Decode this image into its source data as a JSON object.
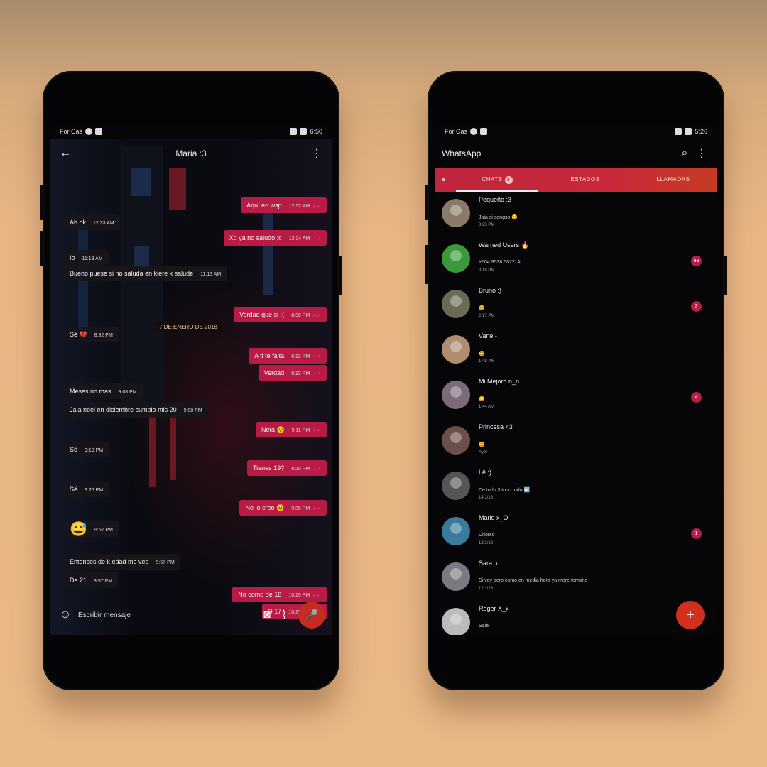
{
  "left_phone": {
    "status": {
      "carrier": "For Cas",
      "time": "6:50"
    },
    "header": {
      "title": "Maria :3",
      "back_icon": "arrow-left-icon",
      "menu_icon": "more-vert-icon"
    },
    "messages": [
      {
        "dir": "out",
        "text": "Aquí en wsp",
        "time": "12:32 AM"
      },
      {
        "dir": "in",
        "text": "Ah ok",
        "time": "12:33 AM"
      },
      {
        "dir": "out",
        "text": "Xq ya no saludo :c",
        "time": "12:34 AM"
      },
      {
        "dir": "in",
        "text": "Io",
        "time": "11:13 AM"
      },
      {
        "dir": "in",
        "text": "Bueno puese si no saluda en kiere k salude",
        "time": "11:13 AM"
      },
      {
        "dir": "out",
        "text": "Verdad que si :(",
        "time": "8:30 PM"
      },
      {
        "dir": "in",
        "text": "Sé 💔",
        "time": "8:32 PM"
      },
      {
        "dir": "out",
        "text": "A ti te falta",
        "time": "6:33 PM"
      },
      {
        "dir": "out",
        "text": "Verdad",
        "time": "6:33 PM"
      },
      {
        "dir": "in",
        "text": "Meses no mas",
        "time": "9:08 PM"
      },
      {
        "dir": "in",
        "text": "Jaja noel en diciembre cumplo mis 20",
        "time": "9:08 PM"
      },
      {
        "dir": "out",
        "text": "Neta 😯",
        "time": "9:11 PM"
      },
      {
        "dir": "in",
        "text": "Sé",
        "time": "9:19 PM"
      },
      {
        "dir": "out",
        "text": "Tienes 19?",
        "time": "9:20 PM"
      },
      {
        "dir": "in",
        "text": "Sé",
        "time": "9:26 PM"
      },
      {
        "dir": "out",
        "text": "No lo creo 😉",
        "time": "9:36 PM"
      },
      {
        "dir": "in",
        "text": "😅",
        "time": "9:57 PM"
      },
      {
        "dir": "in",
        "text": "Entonces de k edad me vee",
        "time": "9:57 PM"
      },
      {
        "dir": "in",
        "text": "De 21",
        "time": "9:57 PM"
      },
      {
        "dir": "out",
        "text": "No como de 18",
        "time": "10:25 PM"
      },
      {
        "dir": "out",
        "text": "O 17",
        "time": "10:25 PM"
      }
    ],
    "date_divider": "7 DE ENERO DE 2018",
    "composer": {
      "placeholder": "Escribir mensaje",
      "emoji_icon": "emoji-icon",
      "camera_icon": "camera-icon",
      "attach_icon": "paperclip-icon",
      "mic_icon": "mic-icon"
    }
  },
  "right_phone": {
    "status": {
      "carrier": "For Cas",
      "time": "5:26"
    },
    "header": {
      "title": "WhatsApp",
      "search_icon": "search-icon",
      "menu_icon": "more-vert-icon"
    },
    "tabs": [
      {
        "label": "CHATS",
        "badge": "8"
      },
      {
        "label": "ESTADOS"
      },
      {
        "label": "LLAMADAS"
      }
    ],
    "chats": [
      {
        "name": "Pequeño :3",
        "preview": "Jaja si sengso 😋",
        "time": "3:25 PM",
        "count": "",
        "color": "#8a7a6a"
      },
      {
        "name": "Warned Users 🔥",
        "preview": "+504 9538 5822: A",
        "time": "3:18 PM",
        "count": "93",
        "color": "#3a9a3a"
      },
      {
        "name": "Bruno :)",
        "preview": "😋",
        "time": "2:17 PM",
        "count": "3",
        "color": "#6a6a55"
      },
      {
        "name": "Vane -",
        "preview": "😋",
        "time": "1:48 PM",
        "count": "",
        "color": "#b08c70"
      },
      {
        "name": "Mi Mejoro n_n",
        "preview": "😋",
        "time": "1:44 AM",
        "count": "4",
        "color": "#7a6a7a"
      },
      {
        "name": "Princesa <3",
        "preview": "😋",
        "time": "Ayer",
        "count": "",
        "color": "#6a5048"
      },
      {
        "name": "Lê :)",
        "preview": "De todo 3 todo todo ☑️",
        "time": "14/1/18",
        "count": "",
        "color": "#555"
      },
      {
        "name": "Mario x_O",
        "preview": "Chorso",
        "time": "12/1/18",
        "count": "1",
        "color": "#3a7a9a"
      },
      {
        "name": "Sara :\\",
        "preview": "Si voy pero como en media hora ya mere termino",
        "time": "12/1/18",
        "count": "",
        "color": "#7a7a82"
      },
      {
        "name": "Roger X_x",
        "preview": "Sale",
        "time": "",
        "count": "",
        "color": "#bbb"
      }
    ],
    "fab_icon": "plus-icon"
  }
}
